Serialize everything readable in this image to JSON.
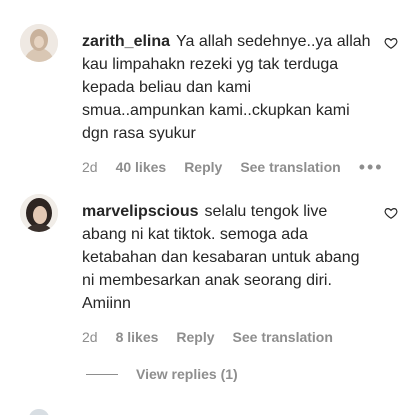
{
  "comments": [
    {
      "username": "zarith_elina",
      "text": "Ya allah sedehnye..ya allah kau limpahakn rezeki yg tak terduga kepada beliau dan kami smua..ampunkan kami..ckupkan kami dgn rasa syukur",
      "time": "2d",
      "likes": "40 likes",
      "reply": "Reply",
      "translate": "See translation",
      "more": "•••"
    },
    {
      "username": "marvelipscious",
      "text": "selalu tengok live abang ni kat tiktok. semoga ada ketabahan dan kesabaran untuk abang ni membesarkan anak seorang diri. Amiinn",
      "time": "2d",
      "likes": "8 likes",
      "reply": "Reply",
      "translate": "See translation"
    }
  ],
  "view_replies": "View replies (1)",
  "icons": {
    "like": "heart-icon",
    "more": "more-options-icon"
  }
}
